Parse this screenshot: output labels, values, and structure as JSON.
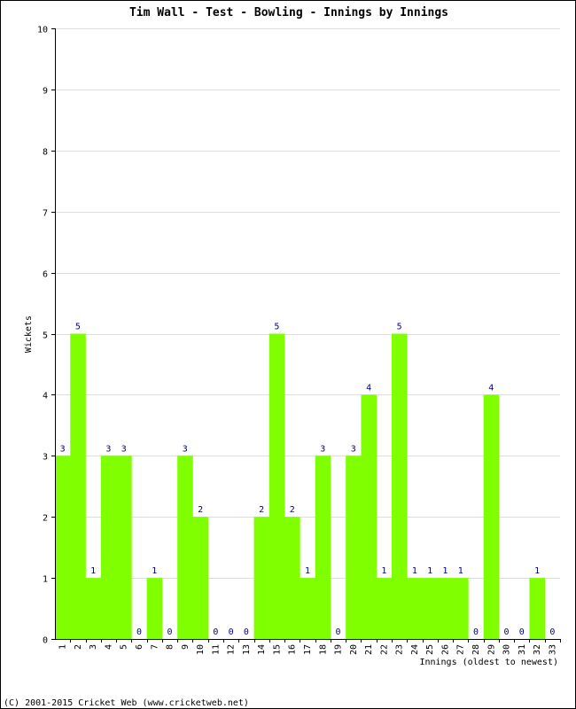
{
  "chart_data": {
    "type": "bar",
    "title": "Tim Wall - Test - Bowling - Innings by Innings",
    "xlabel": "Innings (oldest to newest)",
    "ylabel": "Wickets",
    "ylim": [
      0,
      10
    ],
    "yticks": [
      0,
      1,
      2,
      3,
      4,
      5,
      6,
      7,
      8,
      9,
      10
    ],
    "grid": true,
    "bar_color": "#80ff00",
    "label_color": "#000080",
    "grid_color": "#dddddd",
    "categories": [
      "1",
      "2",
      "3",
      "4",
      "5",
      "6",
      "7",
      "8",
      "9",
      "10",
      "11",
      "12",
      "13",
      "14",
      "15",
      "16",
      "17",
      "18",
      "19",
      "20",
      "21",
      "22",
      "23",
      "24",
      "25",
      "26",
      "27",
      "28",
      "29",
      "30",
      "31",
      "32",
      "33"
    ],
    "values": [
      3,
      5,
      1,
      3,
      3,
      0,
      1,
      0,
      3,
      2,
      0,
      0,
      0,
      2,
      5,
      2,
      1,
      3,
      0,
      3,
      4,
      1,
      5,
      1,
      1,
      1,
      1,
      0,
      4,
      0,
      0,
      1,
      0
    ]
  },
  "footer": "(C) 2001-2015 Cricket Web (www.cricketweb.net)"
}
